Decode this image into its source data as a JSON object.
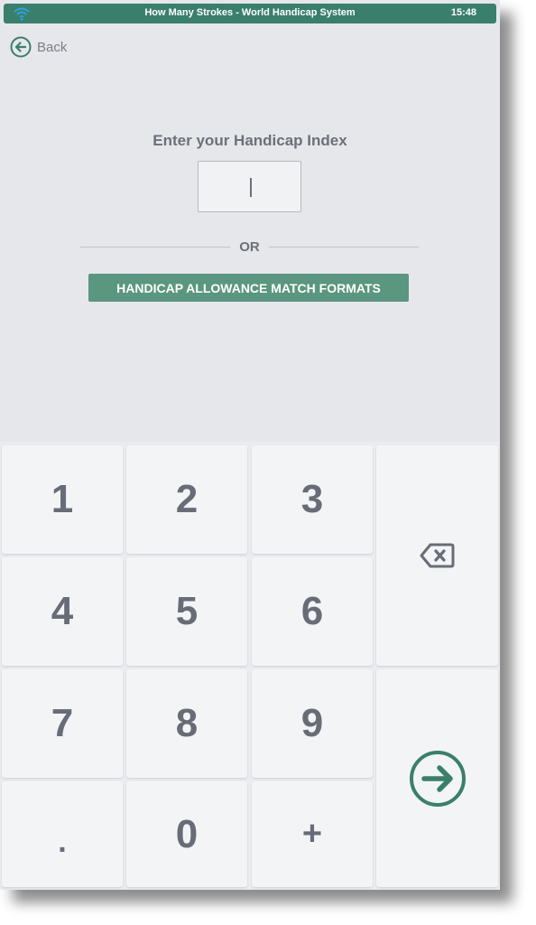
{
  "status_bar": {
    "title": "How Many Strokes - World Handicap System",
    "time": "15:48",
    "wifi_icon": "wifi-icon",
    "background": "#3a7f6a"
  },
  "nav": {
    "back_label": "Back",
    "back_icon": "back-arrow-circle-icon"
  },
  "form": {
    "prompt": "Enter your Handicap Index",
    "index_value": "",
    "divider_text": "OR",
    "formats_button_label": "HANDICAP ALLOWANCE MATCH FORMATS"
  },
  "keypad": {
    "keys": [
      "1",
      "2",
      "3",
      "4",
      "5",
      "6",
      "7",
      "8",
      "9",
      ".",
      "0",
      "+"
    ],
    "backspace_icon": "backspace-icon",
    "submit_icon": "arrow-right-circle-icon"
  },
  "colors": {
    "accent": "#3a7f6a",
    "button": "#5a9680",
    "text": "#6c7079",
    "background": "#e6e7eb",
    "key": "#f3f4f6"
  }
}
